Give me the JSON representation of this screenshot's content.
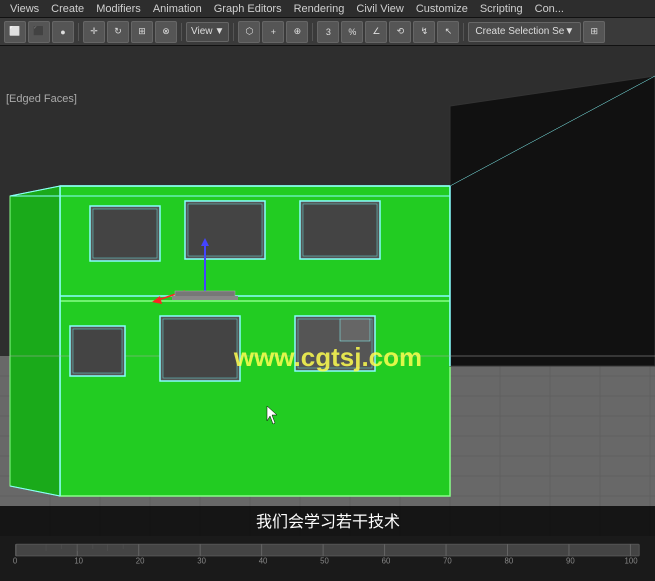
{
  "menubar": {
    "items": [
      {
        "label": "Views",
        "id": "menu-views"
      },
      {
        "label": "Create",
        "id": "menu-create"
      },
      {
        "label": "Modifiers",
        "id": "menu-modifiers"
      },
      {
        "label": "Animation",
        "id": "menu-animation"
      },
      {
        "label": "Graph Editors",
        "id": "menu-graph-editors"
      },
      {
        "label": "Rendering",
        "id": "menu-rendering"
      },
      {
        "label": "Civil View",
        "id": "menu-civil-view"
      },
      {
        "label": "Customize",
        "id": "menu-customize"
      },
      {
        "label": "Scripting",
        "id": "menu-scripting"
      },
      {
        "label": "Con...",
        "id": "menu-con"
      }
    ]
  },
  "toolbar": {
    "view_label": "View",
    "create_selection_label": "Create Selection Se",
    "number_3": "3"
  },
  "viewport": {
    "corner_label": "[Edged Faces]",
    "watermark": "www.cgtsj.com"
  },
  "subtitle": {
    "text": "我们会学习若干技术"
  },
  "timeline": {
    "numbers": [
      "0",
      "10",
      "20",
      "30",
      "40",
      "50",
      "60",
      "70",
      "80",
      "90",
      "100"
    ]
  }
}
